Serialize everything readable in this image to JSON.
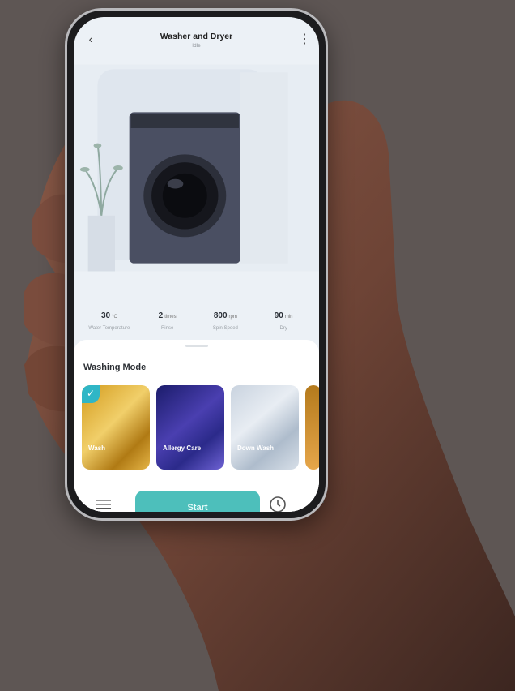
{
  "header": {
    "title": "Washer and Dryer",
    "subtitle": "Idle",
    "back_icon": "chevron-left-icon",
    "more_icon": "vertical-dots-icon"
  },
  "status": {
    "primary": "",
    "secondary": "",
    "description": ""
  },
  "stats": [
    {
      "value": "30",
      "unit": "°C",
      "label": "Water Temperature"
    },
    {
      "value": "2",
      "unit": "times",
      "label": "Rinse"
    },
    {
      "value": "800",
      "unit": "rpm",
      "label": "Spin Speed"
    },
    {
      "value": "90",
      "unit": "min",
      "label": "Dry"
    }
  ],
  "washing_mode": {
    "title": "Washing Mode",
    "modes": [
      {
        "name": "Wash",
        "time": "",
        "selected": true
      },
      {
        "name": "Allergy Care",
        "time": "",
        "selected": false
      },
      {
        "name": "Down Wash",
        "time": "",
        "selected": false
      }
    ]
  },
  "bottom": {
    "start_label": "Start",
    "menu_icon": "menu-icon",
    "history_icon": "clock-icon"
  },
  "colors": {
    "accent": "#4dbfbb",
    "background": "#5e5654",
    "check": "#2fb6c6"
  }
}
